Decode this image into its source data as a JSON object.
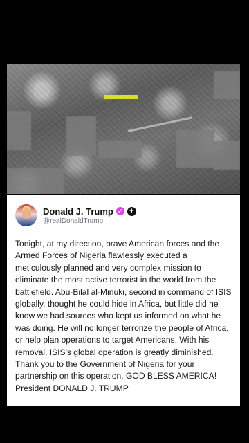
{
  "video": {
    "description_icon": "aerial-footage"
  },
  "tweet": {
    "display_name": "Donald J. Trump",
    "handle": "@realDonaldTrump",
    "verified_icon": "verified-badge-icon",
    "follow_icon": "add-follow-icon",
    "body": "Tonight, at my direction, brave American forces and the Armed Forces of Nigeria flawlessly executed a meticulously planned and very complex mission to eliminate the most active terrorist in the world from the battlefield. Abu-Bilal al-Minuki, second in command of ISIS globally, thought he could hide in Africa, but little did he know we had sources who kept us informed on what he was doing. He will no longer terrorize the people of Africa, or help plan operations to target Americans. With his removal, ISIS's global operation is greatly diminished. Thank you to the Government of Nigeria for your partnership on this operation. GOD BLESS AMERICA! President DONALD J. TRUMP"
  },
  "colors": {
    "background": "#000000",
    "card": "#ffffff",
    "verified": "#d946ef",
    "marker": "#d6df2a"
  }
}
